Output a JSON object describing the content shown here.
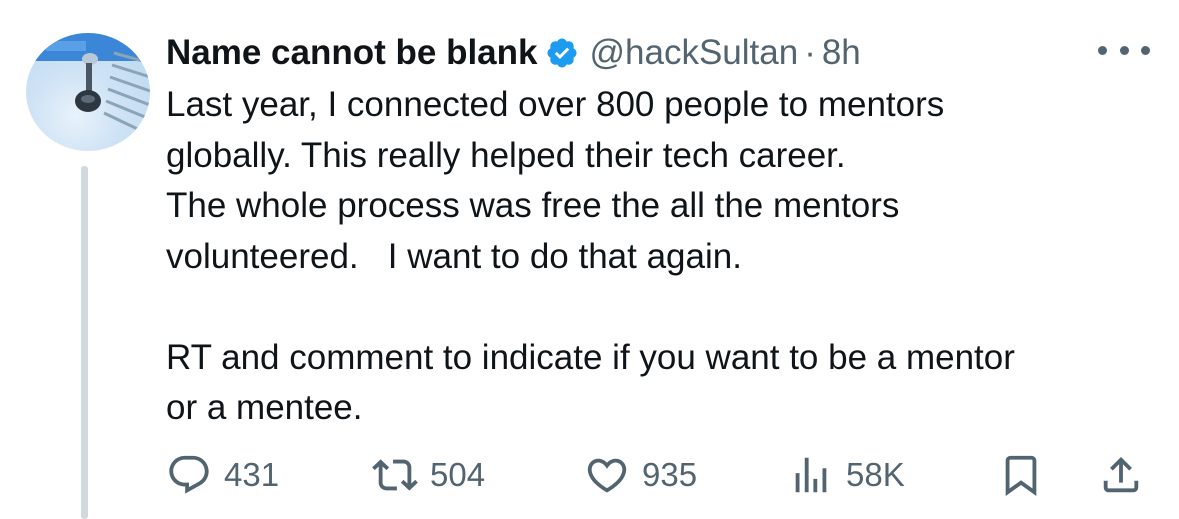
{
  "author": {
    "name": "Name cannot be blank",
    "handle": "@hackSultan",
    "separator": "·",
    "time": "8h",
    "verified": true
  },
  "tweet": {
    "text": "Last year, I connected over 800 people to mentors\nglobally. This really helped their tech career.\nThe whole process was free the all the mentors\nvolunteered.   I want to do that again.\n\nRT and comment to indicate if you want to be a mentor\nor a mentee."
  },
  "actions": {
    "replies": "431",
    "retweets": "504",
    "likes": "935",
    "views": "58K"
  },
  "icons": {
    "reply": "reply-icon",
    "retweet": "retweet-icon",
    "like": "heart-icon",
    "views": "views-icon",
    "bookmark": "bookmark-icon",
    "share": "share-icon",
    "more": "more-icon",
    "verified": "verified-badge-icon"
  },
  "colors": {
    "text": "#0f1419",
    "secondary": "#536471",
    "verified": "#1d9bf0",
    "thread_line": "#cfd9de"
  }
}
